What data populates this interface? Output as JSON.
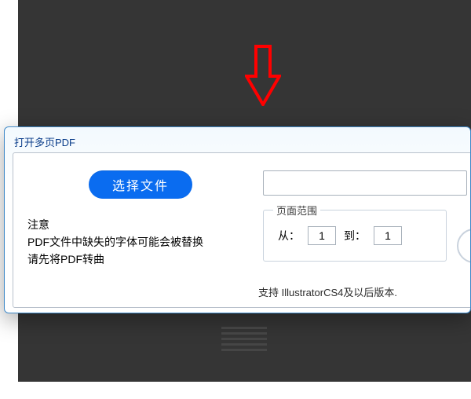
{
  "dialog": {
    "title": "打开多页PDF",
    "choose_file_label": "选择文件",
    "file_path_value": "",
    "notice": {
      "heading": "注意",
      "line1": "PDF文件中缺失的字体可能会被替换",
      "line2": "请先将PDF转曲"
    },
    "page_range": {
      "legend": "页面范围",
      "from_label": "从：",
      "from_value": "1",
      "to_label": "到：",
      "to_value": "1"
    },
    "support_note": "支持 IllustratorCS4及以后版本."
  },
  "annotation": {
    "arrow_color": "#ff0000"
  }
}
